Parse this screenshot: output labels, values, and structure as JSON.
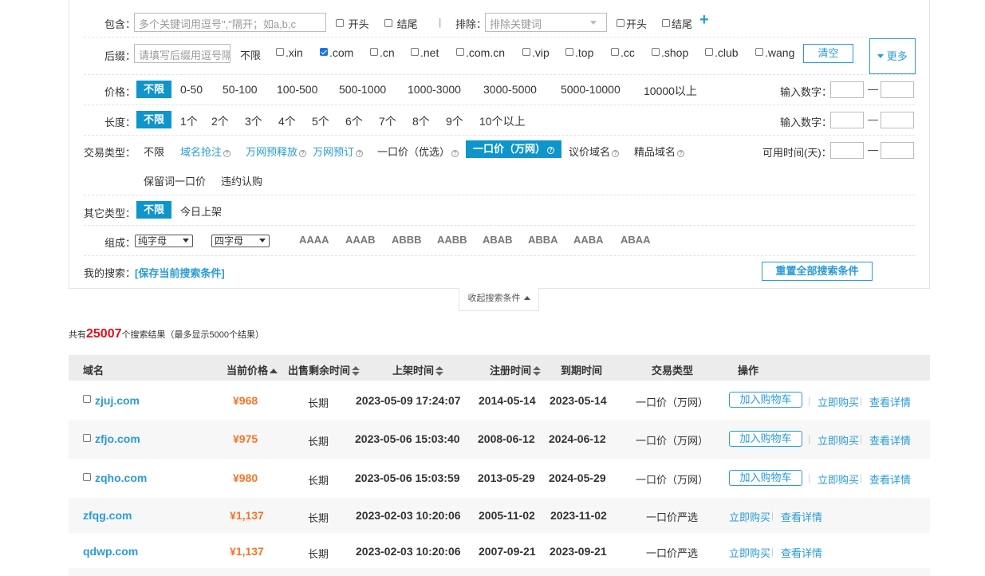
{
  "filters": {
    "contains": {
      "label": "包含：",
      "placeholder": "多个关键词用逗号\",\"隔开；如a,b,c",
      "start": "开头",
      "end": "结尾",
      "divider": "|"
    },
    "exclude": {
      "label": "排除：",
      "placeholder": "排除关键词",
      "start": "开头",
      "end": "结尾",
      "add": "+"
    },
    "suffix": {
      "label": "后缀：",
      "placeholder": "请填写后缀用逗号隔开",
      "any": "不限",
      "items": [
        ".xin",
        ".com",
        ".cn",
        ".net",
        ".com.cn",
        ".vip",
        ".top",
        ".cc",
        ".shop",
        ".club",
        ".wang"
      ],
      "clear": "清空",
      "more": "更多"
    },
    "price": {
      "label": "价格：",
      "selected": "不限",
      "options": [
        "0-50",
        "50-100",
        "100-500",
        "500-1000",
        "1000-3000",
        "3000-5000",
        "5000-10000",
        "10000以上"
      ],
      "input_label": "输入数字：",
      "dash": "—"
    },
    "length": {
      "label": "长度：",
      "selected": "不限",
      "options": [
        "1个",
        "2个",
        "3个",
        "4个",
        "5个",
        "6个",
        "7个",
        "8个",
        "9个",
        "10个以上"
      ],
      "input_label": "输入数字：",
      "dash": "—"
    },
    "trade": {
      "label": "交易类型：",
      "any": "不限",
      "o1": "域名抢注",
      "o2": "万网预释放",
      "o3": "万网预订",
      "o4": "一口价（优选）",
      "o5": "一口价（万网）",
      "o6": "议价域名",
      "o7": "精品域名",
      "o8": "保留词一口价",
      "o9": "违约认购",
      "q": "?",
      "time_label": "可用时间(天)：",
      "dash": "—"
    },
    "other": {
      "label": "其它类型：",
      "selected": "不限",
      "today": "今日上架"
    },
    "compose": {
      "label": "组成：",
      "select1": "纯字母",
      "select2": "四字母",
      "patterns": [
        "AAAA",
        "AAAB",
        "ABBB",
        "AABB",
        "ABAB",
        "ABBA",
        "AABA",
        "ABAA"
      ]
    },
    "mine": {
      "label": "我的搜索：",
      "save": "[保存当前搜索条件]",
      "reset": "重置全部搜索条件"
    }
  },
  "collapse": "收起搜索条件",
  "summary": {
    "prefix": "共有",
    "count": "25007",
    "suffix": "个搜索结果（最多显示5000个结果）"
  },
  "table": {
    "headers": {
      "domain": "域名",
      "price": "当前价格",
      "remain": "出售剩余时间",
      "listed": "上架时间",
      "registered": "注册时间",
      "expire": "到期时间",
      "type": "交易类型",
      "ops": "操作"
    },
    "actions": {
      "cart": "加入购物车",
      "buy": "立即购买",
      "detail": "查看详情",
      "sep": "|"
    },
    "rows": [
      {
        "domain": "zjuj.com",
        "price": "¥968",
        "remain": "长期",
        "listed": "2023-05-09 17:24:07",
        "registered": "2014-05-14",
        "expire": "2023-05-14",
        "type": "一口价（万网）"
      },
      {
        "domain": "zfjo.com",
        "price": "¥975",
        "remain": "长期",
        "listed": "2023-05-06 15:03:40",
        "registered": "2008-06-12",
        "expire": "2024-06-12",
        "type": "一口价（万网）"
      },
      {
        "domain": "zqho.com",
        "price": "¥980",
        "remain": "长期",
        "listed": "2023-05-06 15:03:59",
        "registered": "2013-05-29",
        "expire": "2024-05-29",
        "type": "一口价（万网）"
      },
      {
        "domain": "zfqg.com",
        "price": "¥1,137",
        "remain": "长期",
        "listed": "2023-02-03 10:20:06",
        "registered": "2005-11-02",
        "expire": "2023-11-02",
        "type": "一口价严选"
      },
      {
        "domain": "qdwp.com",
        "price": "¥1,137",
        "remain": "长期",
        "listed": "2023-02-03 10:20:06",
        "registered": "2007-09-21",
        "expire": "2023-09-21",
        "type": "一口价严选"
      }
    ]
  }
}
